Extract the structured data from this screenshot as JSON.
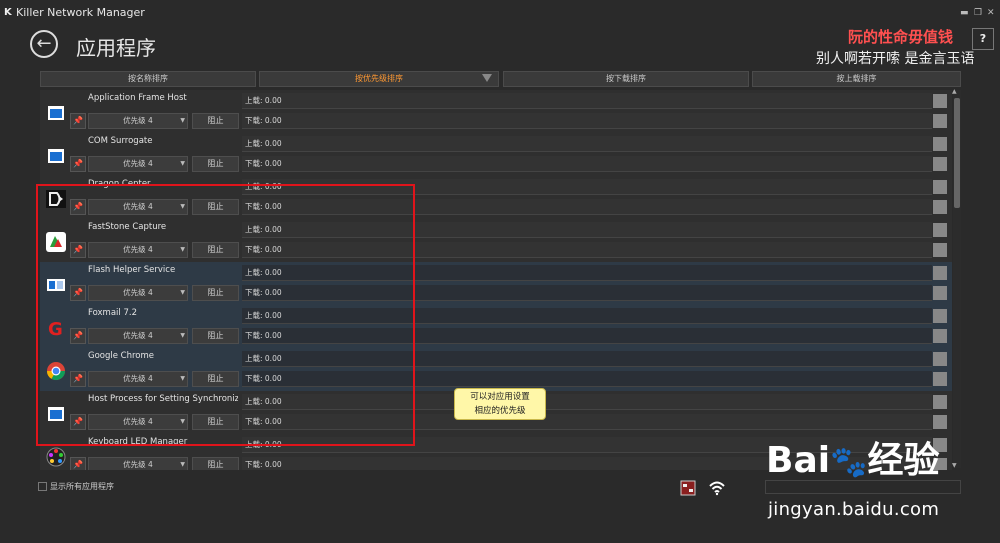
{
  "window": {
    "logo": "K",
    "title": "Killer Network Manager",
    "controls": [
      "▬",
      "❐",
      "✕"
    ]
  },
  "header": {
    "title": "应用程序",
    "help": "?"
  },
  "watermark": {
    "line1": "阮的性命毋值钱",
    "line2": "别人啊若开嗦 是金言玉语"
  },
  "sort": {
    "buttons": [
      "按名称排序",
      "按优先级排序",
      "按下载排序",
      "按上载排序"
    ],
    "active_index": 1
  },
  "apps": [
    {
      "name": "Application Frame Host",
      "priority": "优先级 4",
      "block": "阻止",
      "upload": "上载: 0.00",
      "download": "下载: 0.00",
      "highlight": false
    },
    {
      "name": "COM Surrogate",
      "priority": "优先级 4",
      "block": "阻止",
      "upload": "上载: 0.00",
      "download": "下载: 0.00",
      "highlight": false
    },
    {
      "name": "Dragon Center",
      "priority": "优先级 4",
      "block": "阻止",
      "upload": "上载: 0.00",
      "download": "下载: 0.00",
      "highlight": false
    },
    {
      "name": "FastStone Capture",
      "priority": "优先级 4",
      "block": "阻止",
      "upload": "上载: 0.00",
      "download": "下载: 0.00",
      "highlight": false
    },
    {
      "name": "Flash Helper Service",
      "priority": "优先级 4",
      "block": "阻止",
      "upload": "上载: 0.00",
      "download": "下载: 0.00",
      "highlight": true
    },
    {
      "name": "Foxmail 7.2",
      "priority": "优先级 4",
      "block": "阻止",
      "upload": "上载: 0.00",
      "download": "下载: 0.00",
      "highlight": true
    },
    {
      "name": "Google Chrome",
      "priority": "优先级 4",
      "block": "阻止",
      "upload": "上载: 0.00",
      "download": "下载: 0.00",
      "highlight": true
    },
    {
      "name": "Host Process for Setting Synchroniz...",
      "priority": "优先级 4",
      "block": "阻止",
      "upload": "上载: 0.00",
      "download": "下载: 0.00",
      "highlight": false
    },
    {
      "name": "Keyboard LED Manager",
      "priority": "优先级 4",
      "block": "阻止",
      "upload": "上载: 0.00",
      "download": "下载: 0.00",
      "highlight": false
    }
  ],
  "tooltip": {
    "line1": "可以对应用设置",
    "line2": "相应的优先级"
  },
  "footer": {
    "show_all": "显示所有应用程序"
  },
  "baidu": {
    "mark": "Bai",
    "mark2": "经验",
    "url": "jingyan.baidu.com"
  },
  "colors": {
    "highlight": "#2e3a46",
    "accent": "#ff9933",
    "annotation": "#e0141b"
  }
}
